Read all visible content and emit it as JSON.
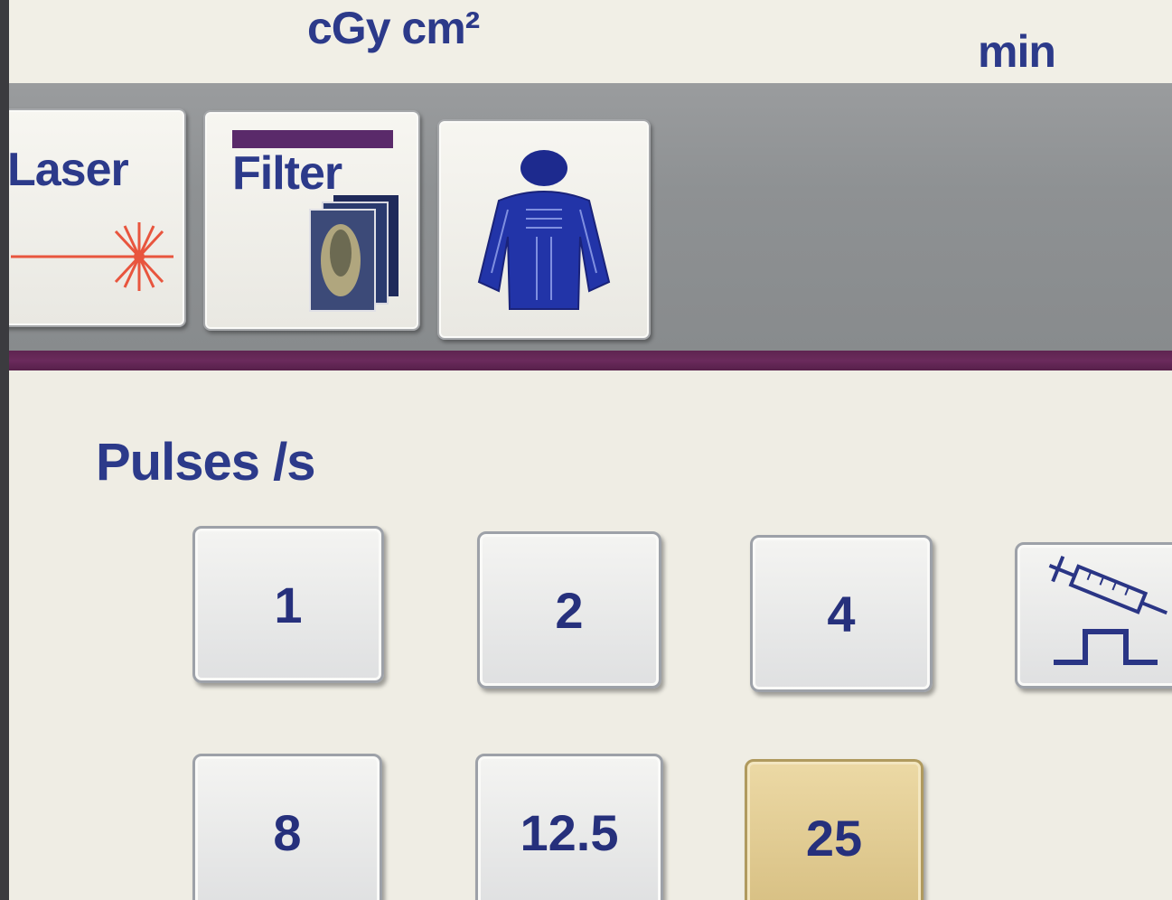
{
  "units": {
    "dose": "cGy cm²",
    "time": "min"
  },
  "tools": {
    "laser_label": "Laser",
    "filter_label": "Filter"
  },
  "pulses": {
    "label": "Pulses /s",
    "rates": [
      "1",
      "2",
      "4",
      "8",
      "12.5",
      "25"
    ],
    "selected": "25"
  },
  "colors": {
    "text": "#2c3a8a",
    "accent_purple": "#6b2b5c",
    "selected_button": "#d7bf82"
  },
  "icons": {
    "laser": "laser-beam-icon",
    "filter": "filter-images-icon",
    "body": "patient-body-icon",
    "injector": "contrast-injector-pulse-icon"
  }
}
